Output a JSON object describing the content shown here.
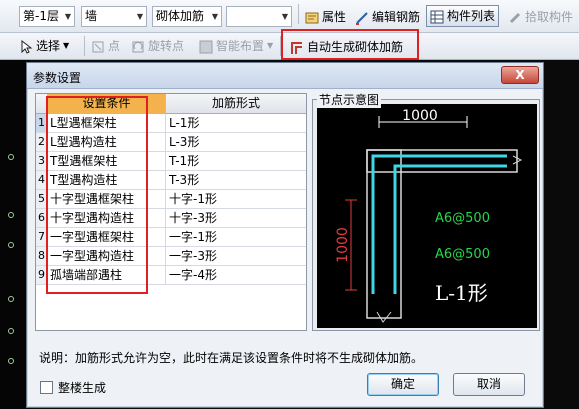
{
  "toolbar": {
    "floor_select": "第-1层",
    "type_select": "墙",
    "sub_select": "砌体加筋",
    "empty_select": "",
    "property_label": "属性",
    "edit_rebar_label": "编辑钢筋",
    "component_list_label": "构件列表",
    "pick_component_label": "拾取构件"
  },
  "toolbar2": {
    "select_label": "选择",
    "point_label": "点",
    "rotate_point_label": "旋转点",
    "smart_layout_label": "智能布置",
    "auto_generate_label": "自动生成砌体加筋"
  },
  "dialog": {
    "title": "参数设置",
    "close_label": "X",
    "table": {
      "headers": [
        "设置条件",
        "加筋形式"
      ],
      "rows": [
        {
          "num": "1",
          "cond": "L型遇框架柱",
          "form": "L-1形"
        },
        {
          "num": "2",
          "cond": "L型遇构造柱",
          "form": "L-3形"
        },
        {
          "num": "3",
          "cond": "T型遇框架柱",
          "form": "T-1形"
        },
        {
          "num": "4",
          "cond": "T型遇构造柱",
          "form": "T-3形"
        },
        {
          "num": "5",
          "cond": "十字型遇框架柱",
          "form": "十字-1形"
        },
        {
          "num": "6",
          "cond": "十字型遇构造柱",
          "form": "十字-3形"
        },
        {
          "num": "7",
          "cond": "一字型遇框架柱",
          "form": "一字-1形"
        },
        {
          "num": "8",
          "cond": "一字型遇构造柱",
          "form": "一字-3形"
        },
        {
          "num": "9",
          "cond": "孤墙端部遇柱",
          "form": "一字-4形"
        }
      ]
    },
    "preview": {
      "group_label": "节点示意图",
      "dim_horizontal": "1000",
      "dim_vertical": "1000",
      "rebar_label_1": "A6@500",
      "rebar_label_2": "A6@500",
      "shape_label": "L-1形"
    },
    "note": "说明：加筋形式允许为空，此时在满足该设置条件时将不生成砌体加筋。",
    "whole_building_label": "整楼生成",
    "ok_label": "确定",
    "cancel_label": "取消"
  },
  "colors": {
    "highlight_red": "#e0201e",
    "header_orange": "#f3b24b",
    "rebar_cyan": "#3fd6e6",
    "label_green": "#22d84a",
    "dim_white": "#ffffff",
    "dim_red": "#e23b3b"
  }
}
